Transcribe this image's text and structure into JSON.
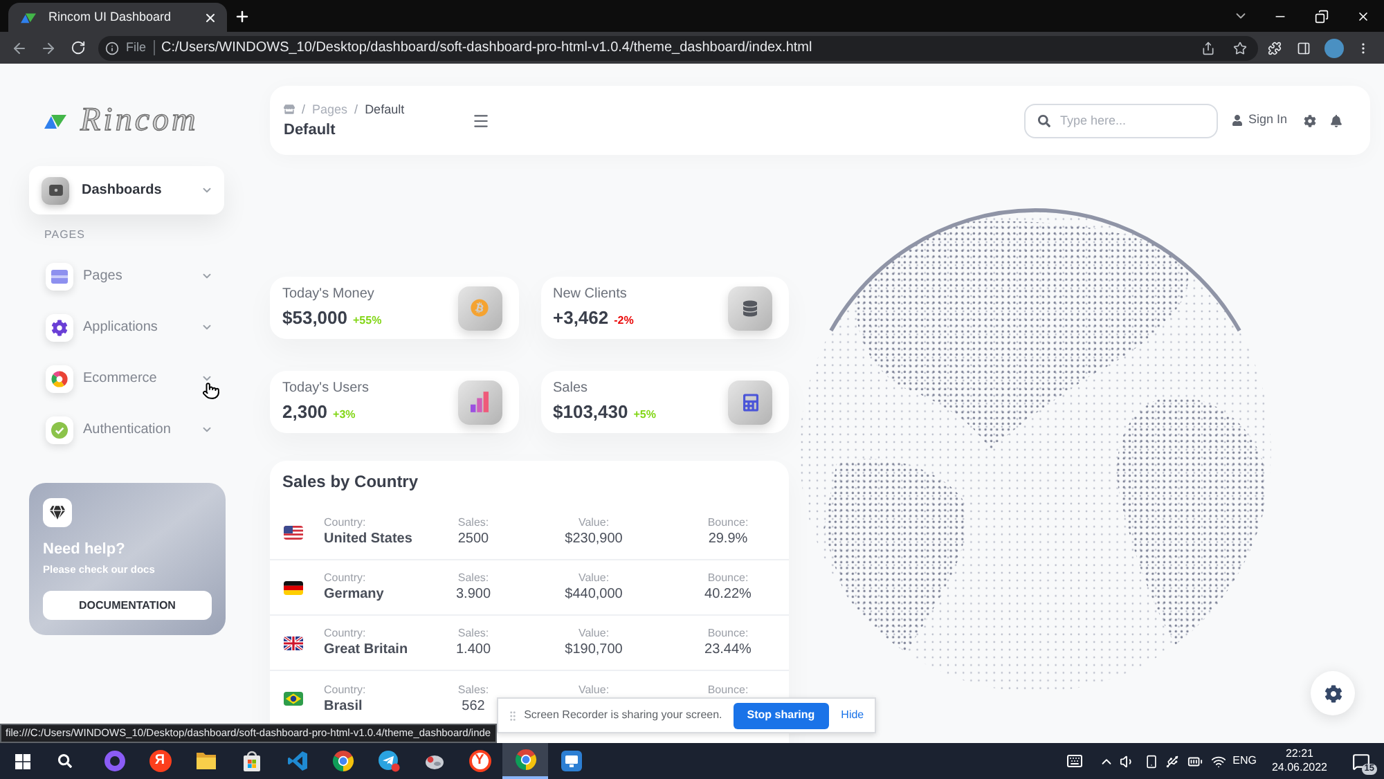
{
  "browser": {
    "tab_title": "Rincom UI Dashboard",
    "address": {
      "scheme": "File",
      "url": "C:/Users/WINDOWS_10/Desktop/dashboard/soft-dashboard-pro-html-v1.0.4/theme_dashboard/index.html"
    }
  },
  "sidebar": {
    "logo": "Rincom",
    "main_items": [
      {
        "label": "Dashboards",
        "selected": true
      }
    ],
    "section": "PAGES",
    "items": [
      {
        "label": "Pages",
        "selected": false
      },
      {
        "label": "Applications",
        "selected": false
      },
      {
        "label": "Ecommerce",
        "selected": false
      },
      {
        "label": "Authentication",
        "selected": false
      }
    ],
    "help_card": {
      "title": "Need help?",
      "text": "Please check our docs",
      "button": "DOCUMENTATION"
    }
  },
  "header": {
    "breadcrumb": [
      {
        "kind": "separator",
        "label": "/"
      },
      {
        "kind": "link",
        "label": "Pages"
      },
      {
        "kind": "separator",
        "label": "/"
      },
      {
        "kind": "current",
        "label": "Default"
      }
    ],
    "title": "Default",
    "search": {
      "placeholder": "Type here..."
    },
    "sign_in": "Sign In"
  },
  "stats": [
    {
      "label": "Today's Money",
      "value": "$53,000",
      "change": "+55%",
      "color": "#82d616"
    },
    {
      "label": "New Clients",
      "value": "+3,462",
      "change": "-2%",
      "color": "#ea0606"
    },
    {
      "label": "Today's Users",
      "value": "2,300",
      "change": "+3%",
      "color": "#82d616"
    },
    {
      "label": "Sales",
      "value": "$103,430",
      "change": "+5%",
      "color": "#82d616"
    }
  ],
  "sales_by_country": {
    "title": "Sales by Country",
    "rows": [
      {
        "country_label": "Country:",
        "country": "United States",
        "sales_label": "Sales:",
        "sales": "2500",
        "value_label": "Value:",
        "value": "$230,900",
        "bounce_label": "Bounce:",
        "bounce": "29.9%"
      },
      {
        "country_label": "Country:",
        "country": "Germany",
        "sales_label": "Sales:",
        "sales": "3.900",
        "value_label": "Value:",
        "value": "$440,000",
        "bounce_label": "Bounce:",
        "bounce": "40.22%"
      },
      {
        "country_label": "Country:",
        "country": "Great Britain",
        "sales_label": "Sales:",
        "sales": "1.400",
        "value_label": "Value:",
        "value": "$190,700",
        "bounce_label": "Bounce:",
        "bounce": "23.44%"
      },
      {
        "country_label": "Country:",
        "country": "Brasil",
        "sales_label": "Sales:",
        "sales": "562",
        "value_label": "Value:",
        "bounce_label": "Bounce:"
      }
    ]
  },
  "status_bubble": "file:///C:/Users/WINDOWS_10/Desktop/dashboard/soft-dashboard-pro-html-v1.0.4/theme_dashboard/inde",
  "screen_share_banner": {
    "message": "Screen Recorder is sharing your screen.",
    "stop_button": "Stop sharing",
    "hide_link": "Hide"
  },
  "taskbar": {
    "apps": [
      {
        "selected": false
      },
      {
        "selected": false,
        "glyph": "Я"
      },
      {
        "selected": false
      },
      {
        "selected": false
      },
      {
        "selected": false
      },
      {
        "selected": false
      },
      {
        "selected": false
      },
      {
        "selected": false
      },
      {
        "selected": false,
        "glyph": "Y"
      },
      {
        "selected": true
      },
      {
        "selected": false
      }
    ],
    "language": "ENG",
    "time": "22:21",
    "date": "24.06.2022",
    "notification_count": "15"
  }
}
